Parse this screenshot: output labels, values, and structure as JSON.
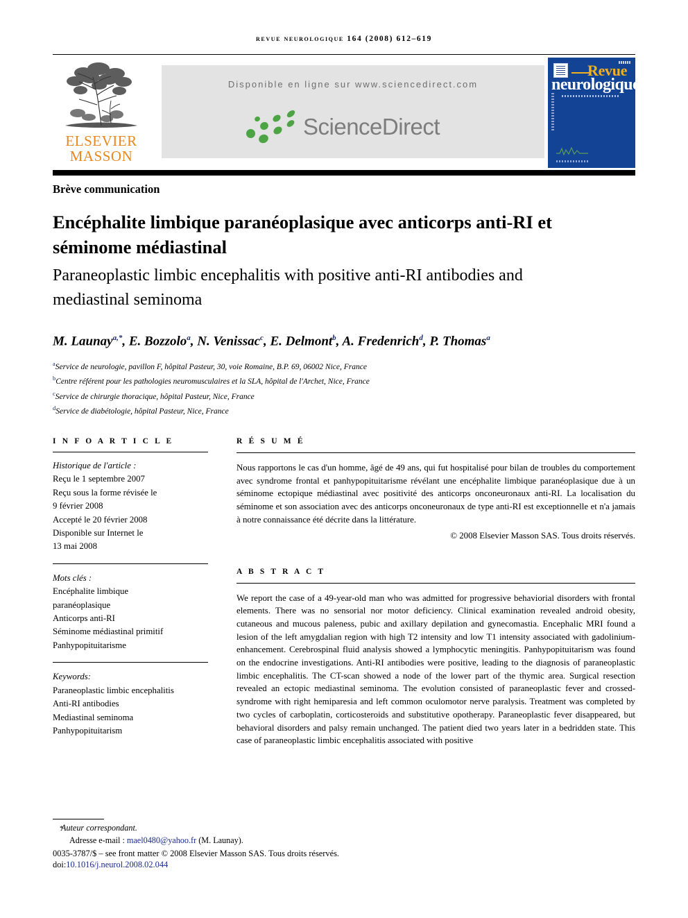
{
  "running_head": "REVUE NEUROLOGIQUE 164 (2008) 612–619",
  "header": {
    "availability_text": "Disponible en ligne sur www.sciencedirect.com",
    "sciencedirect_wordmark": "ScienceDirect",
    "elsevier_line1": "ELSEVIER",
    "elsevier_line2": "MASSON",
    "cover_title_top": "Revue",
    "cover_title_bottom": "neurologique",
    "colors": {
      "elsevier_orange": "#E8871E",
      "sciencedirect_green": "#4CA444",
      "sciencedirect_gray": "#7D7D7D",
      "cover_blue": "#134395",
      "cover_yellow": "#F2B01E",
      "banner_gray": "#E3E3E3",
      "link_blue": "#1a2a8c"
    }
  },
  "article": {
    "type": "Brève communication",
    "title_fr": "Encéphalite limbique paranéoplasique avec anticorps anti-RI et séminome médiastinal",
    "title_en": "Paraneoplastic limbic encephalitis with positive anti-RI antibodies and mediastinal seminoma"
  },
  "authors": {
    "list": [
      {
        "name": "M. Launay",
        "marks": "a,*"
      },
      {
        "name": "E. Bozzolo",
        "marks": "a"
      },
      {
        "name": "N. Venissac",
        "marks": "c"
      },
      {
        "name": "E. Delmont",
        "marks": "b"
      },
      {
        "name": "A. Fredenrich",
        "marks": "d"
      },
      {
        "name": "P. Thomas",
        "marks": "a"
      }
    ],
    "affiliations": [
      {
        "mark": "a",
        "text": "Service de neurologie, pavillon F, hôpital Pasteur, 30, voie Romaine, B.P. 69, 06002 Nice, France"
      },
      {
        "mark": "b",
        "text": "Centre référent pour les pathologies neuromusculaires et la SLA, hôpital de l'Archet, Nice, France"
      },
      {
        "mark": "c",
        "text": "Service de chirurgie thoracique, hôpital Pasteur, Nice, France"
      },
      {
        "mark": "d",
        "text": "Service de diabétologie, hôpital Pasteur, Nice, France"
      }
    ]
  },
  "info_article": {
    "heading": "I N F O   A R T I C L E",
    "history_label": "Historique de l'article :",
    "history_lines": [
      "Reçu le 1 septembre 2007",
      "Reçu sous la forme révisée le",
      "9 février 2008",
      "Accepté le  20 février 2008",
      "Disponible sur Internet le",
      "13 mai 2008"
    ],
    "mots_cles_label": "Mots clés :",
    "mots_cles": [
      "Encéphalite limbique",
      "paranéoplasique",
      "Anticorps anti-RI",
      "Séminome médiastinal primitif",
      "Panhypopituitarisme"
    ],
    "keywords_label": "Keywords:",
    "keywords": [
      "Paraneoplastic limbic encephalitis",
      "Anti-RI antibodies",
      "Mediastinal seminoma",
      "Panhypopituitarism"
    ]
  },
  "resume": {
    "heading": "R É S U M É",
    "body": "Nous rapportons le cas d'un homme, âgé de 49 ans, qui fut hospitalisé pour bilan de troubles du comportement avec syndrome frontal et panhypopituitarisme révélant une encéphalite limbique paranéoplasique due à un séminome ectopique médiastinal avec positivité des anticorps onconeuronaux anti-RI. La localisation du séminome et son association avec des anticorps onconeuronaux de type anti-RI est exceptionnelle et n'a jamais à notre connaissance été décrite dans la littérature.",
    "copyright": "© 2008 Elsevier Masson SAS. Tous droits réservés."
  },
  "abstract": {
    "heading": "A B S T R A C T",
    "body": "We report the case of a 49-year-old man who was admitted for progressive behaviorial disorders with frontal elements. There was no sensorial nor motor deficiency. Clinical examination revealed android obesity, cutaneous and mucous paleness, pubic and axillary depilation and gynecomastia. Encephalic MRI found a lesion of the left amygdalian region with high T2 intensity and low T1 intensity associated with gadolinium-enhancement. Cerebrospinal fluid analysis showed a lymphocytic meningitis. Panhypopituitarism was found on the endocrine investigations. Anti-RI antibodies were positive, leading to the diagnosis of paraneoplastic limbic encephalitis. The CT-scan showed a node of the lower part of the thymic area. Surgical resection revealed an ectopic mediastinal seminoma. The evolution consisted of paraneoplastic fever and crossed-syndrome with right hemiparesia and left common oculomotor nerve paralysis. Treatment was completed by two cycles of carboplatin, corticosteroids and substitutive opotherapy. Paraneoplastic fever disappeared, but behavioral disorders and palsy remain unchanged. The patient died two years later in a bedridden state. This case of paraneoplastic limbic encephalitis associated with positive"
  },
  "footer": {
    "corresponding_label": "Auteur correspondant.",
    "email_label": "Adresse e-mail :",
    "email": "mael0480@yahoo.fr",
    "email_suffix": "(M. Launay).",
    "issn_line": "0035-3787/$ – see front matter © 2008 Elsevier Masson SAS. Tous droits réservés.",
    "doi_label": "doi:",
    "doi": "10.1016/j.neurol.2008.02.044"
  }
}
